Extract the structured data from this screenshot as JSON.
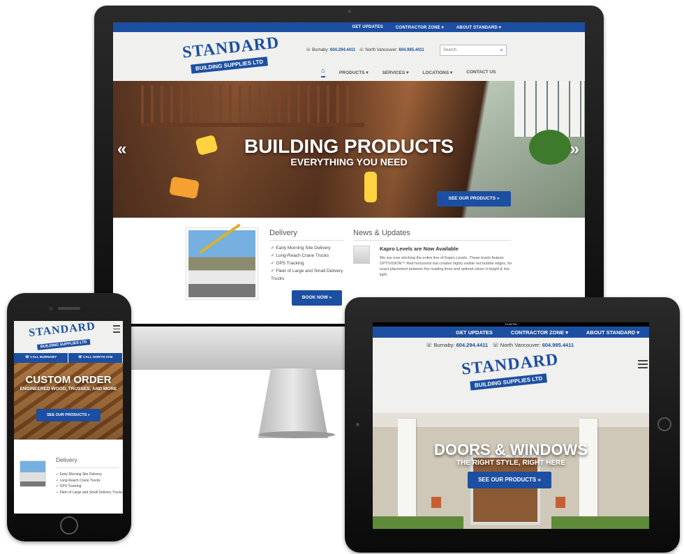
{
  "site": {
    "logo_line1": "STANDARD",
    "logo_line2": "BUILDING SUPPLIES LTD",
    "brand_color": "#1c4fa1"
  },
  "desktop": {
    "topbar": [
      "GET UPDATES",
      "CONTRACTOR ZONE ▾",
      "ABOUT STANDARD ▾"
    ],
    "phones": {
      "burnaby_label": "☏ Burnaby:",
      "burnaby_number": "604.294.4411",
      "north_van_label": "☏ North Vancouver:",
      "north_van_number": "604.985.4411"
    },
    "search_placeholder": "Search",
    "nav": [
      "PRODUCTS ▾",
      "SERVICES ▾",
      "LOCATIONS ▾",
      "CONTACT US"
    ],
    "hero": {
      "title": "BUILDING PRODUCTS",
      "subtitle": "EVERYTHING YOU NEED",
      "cta": "SEE OUR PRODUCTS »"
    },
    "delivery": {
      "heading": "Delivery",
      "items": [
        "Early Morning Site Delivery",
        "Long-Reach Crane Trucks",
        "GPS Tracking",
        "Fleet of Large and Small Delivery Trucks"
      ],
      "button": "BOOK NOW »"
    },
    "news": {
      "heading": "News & Updates",
      "title": "Kapro Levels are Now Available",
      "body": "We are now stocking the entire line of Kapro Levels. These levels feature OPTIVISION™ Red horizontal vial creates highly visible red bubble edges, for exact placement between the reading lines and optimal vision in bright & low light."
    }
  },
  "phone": {
    "callbar": [
      "☏ CALL BURNABY",
      "☏ CALL NORTH VAN"
    ],
    "hero": {
      "title": "CUSTOM ORDER",
      "subtitle": "ENGINEERED WOOD, TRUSSES, AND MORE",
      "cta": "SEE OUR PRODUCTS »"
    },
    "delivery": {
      "heading": "Delivery",
      "items": [
        "Early Morning Site Delivery",
        "Long Reach Crane Trucks",
        "GPS Tracking",
        "Fleet of Large and Small Delivery Trucks"
      ]
    }
  },
  "tablet": {
    "status_time": "12:45 PM",
    "topbar": [
      "GET UPDATES",
      "CONTRACTOR ZONE ▾",
      "ABOUT STANDARD ▾"
    ],
    "phones": {
      "burnaby_label": "☏ Burnaby:",
      "burnaby_number": "604.294.4411",
      "north_van_label": "☏ North Vancouver:",
      "north_van_number": "604.985.4411"
    },
    "hero": {
      "title": "DOORS & WINDOWS",
      "subtitle": "THE RIGHT STYLE, RIGHT HERE",
      "cta": "SEE OUR PRODUCTS »"
    }
  }
}
